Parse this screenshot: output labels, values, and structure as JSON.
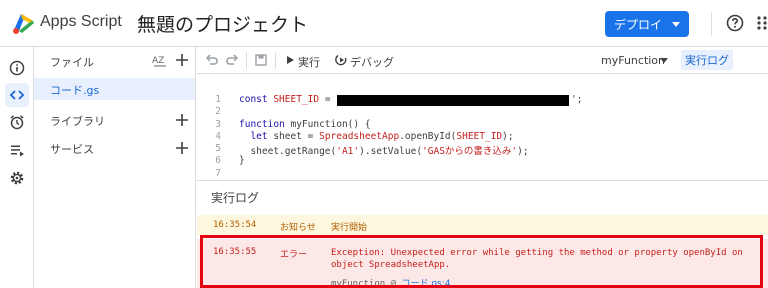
{
  "header": {
    "app_name": "Apps Script",
    "project_title": "無題のプロジェクト",
    "deploy_label": "デプロイ",
    "icons": [
      "apps-script-logo",
      "help-icon",
      "apps-menu-icon"
    ]
  },
  "rail": {
    "items": [
      "info-icon",
      "code-icon",
      "alarm-icon",
      "executions-icon",
      "settings-icon"
    ],
    "active": "code-icon"
  },
  "files": {
    "title": "ファイル",
    "sort_label": "AZ",
    "active_file": "コード.gs",
    "sections": [
      "ライブラリ",
      "サービス"
    ]
  },
  "toolbar": {
    "run_label": "実行",
    "debug_label": "デバッグ",
    "function_name": "myFunction",
    "log_label": "実行ログ"
  },
  "code": {
    "line_numbers": [
      "1",
      "2",
      "3",
      "4",
      "5",
      "6",
      "7"
    ],
    "line1_a": "const ",
    "line1_b": "SHEET_ID",
    "line1_c": " = '",
    "line1_d": "';",
    "line3_a": "function ",
    "line3_b": "myFunction() {",
    "line4_a": "  let ",
    "line4_b": "sheet = ",
    "line4_c": "SpreadsheetApp",
    "line4_d": ".openById(",
    "line4_e": "SHEET_ID",
    "line4_f": ");",
    "line5_a": "  sheet.getRange(",
    "line5_b": "'A1'",
    "line5_c": ").setValue(",
    "line5_d": "'GASからの書き込み'",
    "line5_e": ");",
    "line6": "}"
  },
  "log": {
    "title": "実行ログ",
    "rows": [
      {
        "time": "16:35:54",
        "severity": "お知らせ",
        "message": "実行開始"
      },
      {
        "time": "16:35:55",
        "severity": "エラー",
        "message": "Exception: Unexpected error while getting the method or property openById on object SpreadsheetApp.",
        "stack_fn": "myFunction",
        "stack_at": "@",
        "stack_link": "コード.gs:4"
      }
    ]
  },
  "colors": {
    "accent": "#1a73e8",
    "error": "#c5221f",
    "warning": "#b06000",
    "highlight": "#e50012"
  }
}
